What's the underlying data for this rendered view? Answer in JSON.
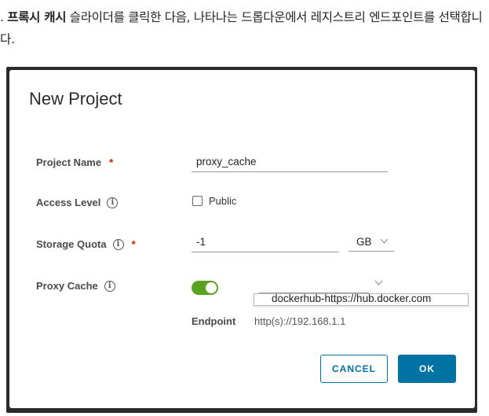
{
  "instruction": {
    "prefix": ". ",
    "bold": "프록시 캐시",
    "rest": " 슬라이더를 클릭한 다음, 나타나는 드롭다운에서 레지스트리 엔드포인트를 선택합니다."
  },
  "dialog": {
    "title": "New Project",
    "project_name": {
      "label": "Project Name",
      "required": "*",
      "value": "proxy_cache"
    },
    "access_level": {
      "label": "Access Level",
      "checkbox_label": "Public",
      "checked": false
    },
    "storage_quota": {
      "label": "Storage Quota",
      "required": "*",
      "value": "-1",
      "unit": "GB"
    },
    "proxy_cache": {
      "label": "Proxy Cache",
      "enabled": true,
      "selected_endpoint": "",
      "dropdown_option": "dockerhub-https://hub.docker.com"
    },
    "endpoint": {
      "label": "Endpoint",
      "value": "http(s)://192.168.1.1"
    },
    "buttons": {
      "cancel": "CANCEL",
      "ok": "OK"
    }
  },
  "colors": {
    "primary": "#0072a3",
    "toggle_on": "#5aa220",
    "required": "#c92100"
  },
  "icons": {
    "info": "info-circle-icon",
    "chevron": "chevron-down-icon"
  }
}
